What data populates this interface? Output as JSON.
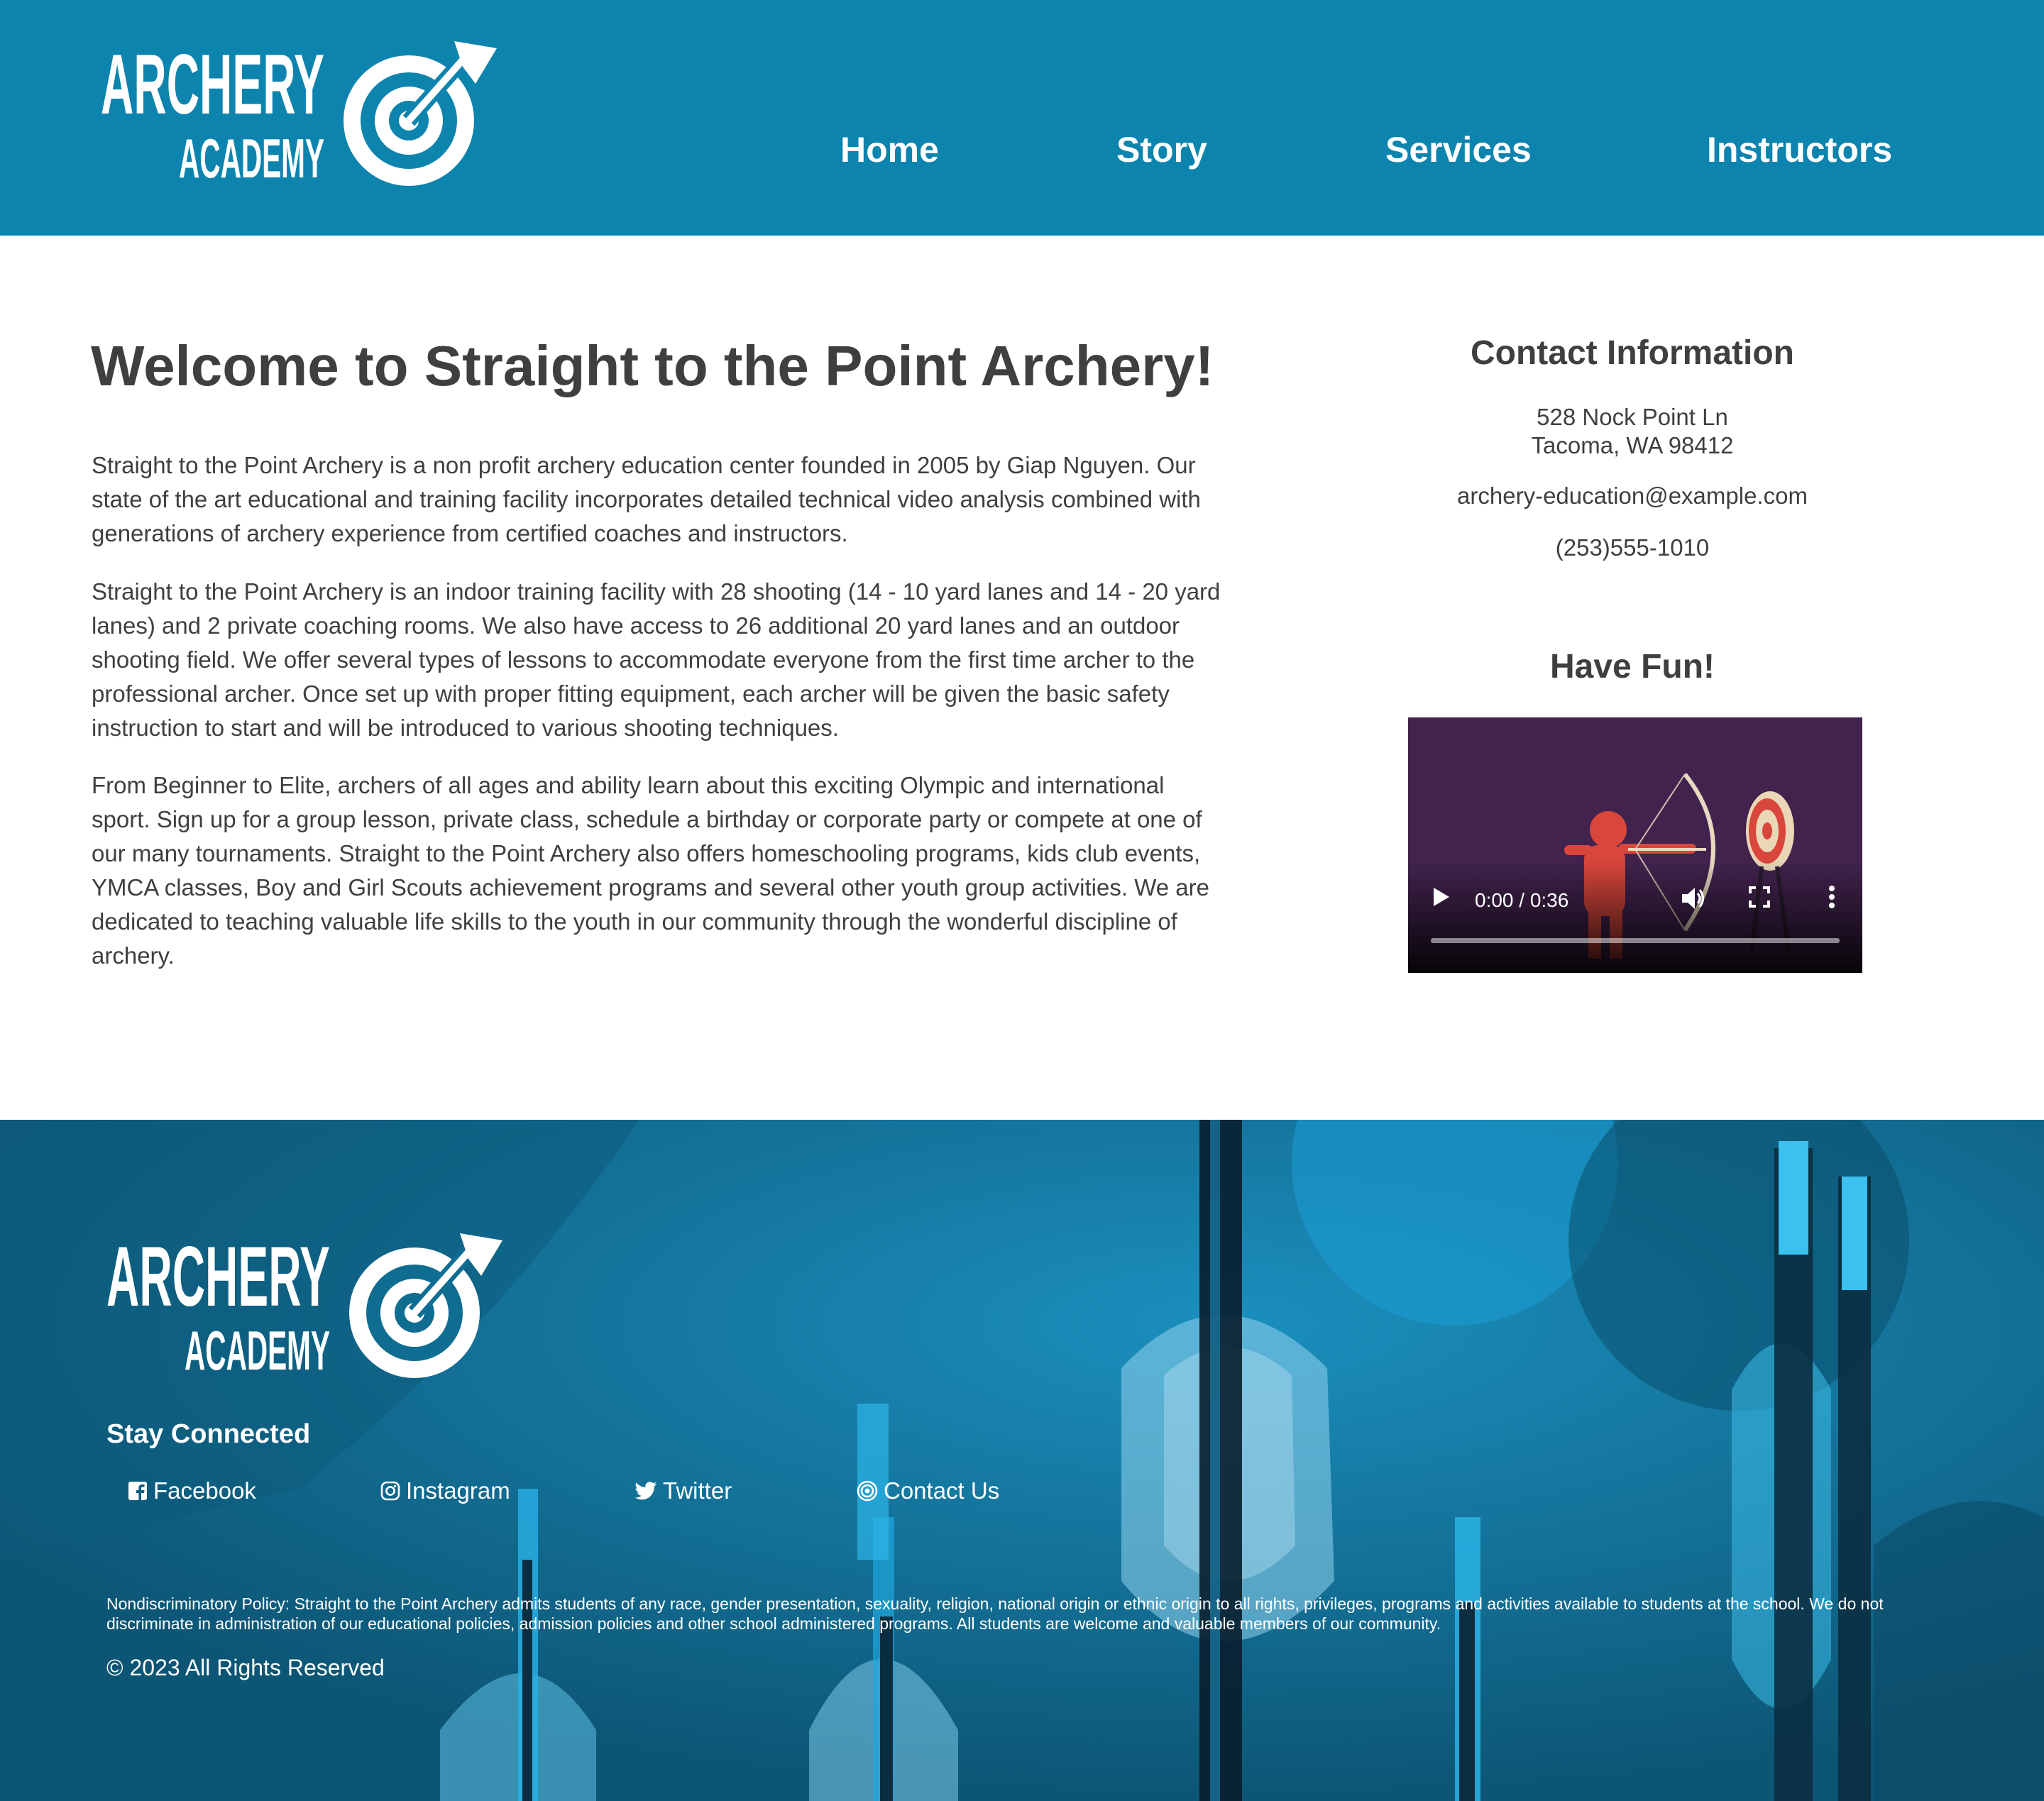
{
  "header": {
    "logo": {
      "line1": "ARCHERY",
      "line2": "ACADEMY",
      "icon": "target-arrow-logo"
    },
    "nav": [
      {
        "label": "Home"
      },
      {
        "label": "Story"
      },
      {
        "label": "Services"
      },
      {
        "label": "Instructors"
      }
    ],
    "colors": {
      "bar": "#0d84ae"
    }
  },
  "main": {
    "title": "Welcome to Straight to the Point Archery!",
    "paragraphs": [
      "Straight to the Point Archery is a non profit archery education center founded in 2005 by Giap Nguyen. Our state of the art educational and training facility incorporates detailed technical video analysis combined with generations of archery experience from certified coaches and instructors.",
      "Straight to the Point Archery is an indoor training facility with 28 shooting (14 - 10 yard lanes and 14 - 20 yard lanes) and 2 private coaching rooms. We also have access to 26 additional 20 yard lanes and an outdoor shooting field. We offer several types of lessons to accommodate everyone from the first time archer to the professional archer. Once set up with proper fitting equipment, each archer will be given the basic safety instruction to start and will be introduced to various shooting techniques.",
      "From Beginner to Elite, archers of all ages and ability learn about this exciting Olympic and international sport. Sign up for a group lesson, private class, schedule a birthday or corporate party or compete at one of our many tournaments. Straight to the Point Archery also offers homeschooling programs, kids club events, YMCA classes, Boy and Girl Scouts achievement programs and several other youth group activities. We are dedicated to teaching valuable life skills to the youth in our community through the wonderful discipline of archery."
    ]
  },
  "aside": {
    "contact_title": "Contact Information",
    "address_line1": "528 Nock Point Ln",
    "address_line2": "Tacoma, WA 98412",
    "email": "archery-education@example.com",
    "phone": "(253)555-1010",
    "fun_title": "Have Fun!",
    "video": {
      "time": "0:00 / 0:36",
      "progress": 0
    }
  },
  "footer": {
    "logo": {
      "line1": "ARCHERY",
      "line2": "ACADEMY"
    },
    "stay_title": "Stay Connected",
    "social": [
      {
        "label": "Facebook",
        "icon": "facebook-icon"
      },
      {
        "label": "Instagram",
        "icon": "instagram-icon"
      },
      {
        "label": "Twitter",
        "icon": "twitter-icon"
      },
      {
        "label": "Contact Us",
        "icon": "target-icon"
      }
    ],
    "policy": "Nondiscriminatory Policy: Straight to the Point Archery admits students of any race, gender presentation, sexuality, religion, national origin or ethnic origin to all rights, privileges, programs and activities available to students at the school. We do not discriminate in administration of our educational policies, admission policies and other school administered programs. All students are welcome and valuable members of our community.",
    "copyright": "© 2023 All Rights Reserved"
  }
}
